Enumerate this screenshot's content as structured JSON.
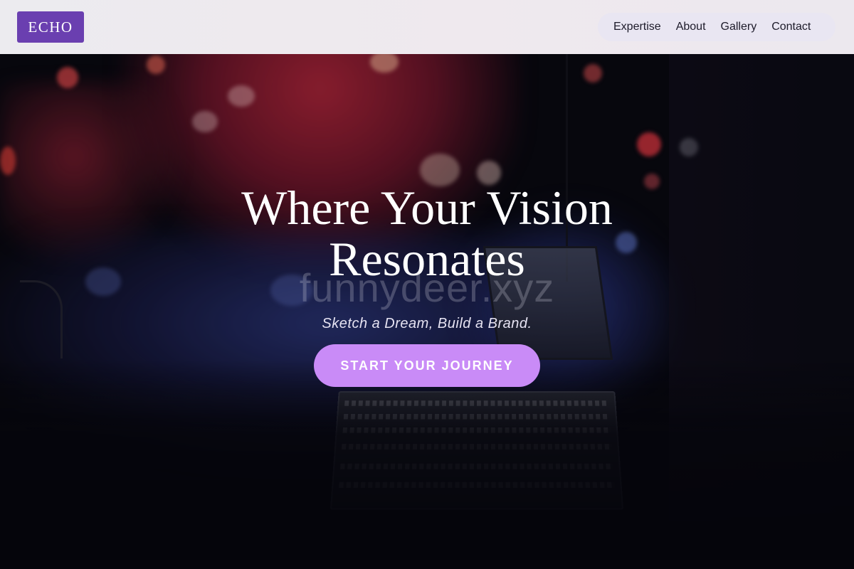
{
  "header": {
    "logo_text": "ECHO",
    "nav": [
      {
        "label": "Expertise"
      },
      {
        "label": "About"
      },
      {
        "label": "Gallery"
      },
      {
        "label": "Contact"
      }
    ]
  },
  "hero": {
    "title_line1": "Where Your Vision",
    "title_line2": "Resonates",
    "watermark": "funnydeer.xyz",
    "tagline": "Sketch a Dream, Build a Brand.",
    "cta_label": "START YOUR JOURNEY"
  },
  "colors": {
    "logo_bg": "#6a3fb0",
    "cta_bg": "#c98bf7",
    "header_bg": "#ecebef",
    "nav_pill_bg": "#e9e6f2"
  }
}
